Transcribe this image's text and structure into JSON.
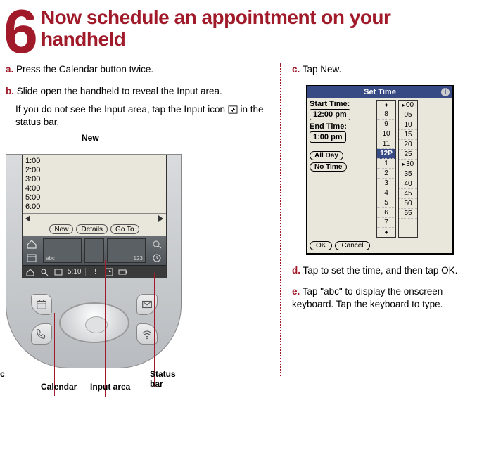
{
  "header": {
    "number": "6",
    "title": "Now schedule an appointment on your handheld"
  },
  "steps": {
    "a": {
      "label": "a.",
      "text": "Press the Calendar button twice."
    },
    "b": {
      "label": "b.",
      "text": "Slide open the handheld to reveal the Input area.",
      "note": "If you do not see the Input area, tap the Input icon      in the status bar."
    },
    "c": {
      "label": "c.",
      "text": "Tap New."
    },
    "d": {
      "label": "d.",
      "text": "Tap to set the time, and then tap OK."
    },
    "e": {
      "label": "e.",
      "text": "Tap \"abc\" to display the onscreen keyboard. Tap the keyboard to type."
    }
  },
  "device": {
    "callouts": {
      "new": "New",
      "abc": "abc",
      "calendar": "Calendar",
      "input_area": "Input area",
      "status_bar": "Status bar"
    },
    "time_rows": [
      "1:00",
      "2:00",
      "3:00",
      "4:00",
      "5:00",
      "6:00"
    ],
    "buttons": {
      "new": "New",
      "details": "Details",
      "goto": "Go To"
    },
    "graffiti": {
      "abc": "abc",
      "num": "123"
    },
    "status": {
      "time": "5:10"
    }
  },
  "dialog": {
    "title": "Set Time",
    "start_label": "Start Time:",
    "start_value": "12:00 pm",
    "end_label": "End Time:",
    "end_value": "1:00 pm",
    "all_day": "All Day",
    "no_time": "No Time",
    "ok": "OK",
    "cancel": "Cancel",
    "hours": [
      "8",
      "9",
      "10",
      "11",
      "12P",
      "1",
      "2",
      "3",
      "4",
      "5",
      "6",
      "7"
    ],
    "hours_selected": "12P",
    "minutes": [
      "00",
      "05",
      "10",
      "15",
      "20",
      "25",
      "30",
      "35",
      "40",
      "45",
      "50",
      "55"
    ],
    "minutes_marked": [
      "00",
      "30"
    ]
  }
}
